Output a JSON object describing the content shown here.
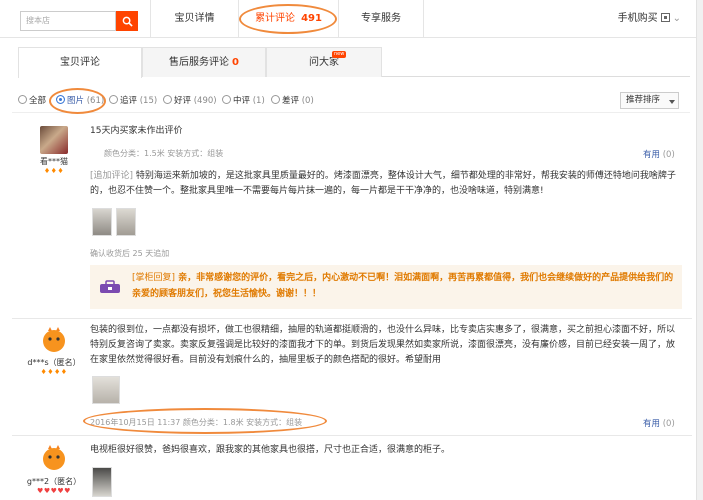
{
  "top": {
    "search_placeholder": "搜本店",
    "tabs": [
      {
        "label": "宝贝详情"
      },
      {
        "label": "累计评论",
        "count": "491"
      },
      {
        "label": "专享服务"
      }
    ],
    "mobile_buy": "手机购买"
  },
  "subtabs": [
    {
      "label": "宝贝评论"
    },
    {
      "label": "售后服务评论",
      "count": "0"
    },
    {
      "label": "问大家",
      "badge": "new"
    }
  ],
  "filters": [
    {
      "label": "全部",
      "count": ""
    },
    {
      "label": "图片",
      "count": "(61)"
    },
    {
      "label": "追评",
      "count": "(15)"
    },
    {
      "label": "好评",
      "count": "(490)"
    },
    {
      "label": "中评",
      "count": "(1)"
    },
    {
      "label": "差评",
      "count": "(0)"
    }
  ],
  "sort_label": "推荐排序",
  "reviews": [
    {
      "user": "看***猫",
      "hearts": "♦♦♦",
      "text": "15天内买家未作出评价",
      "meta": "颜色分类：1.5米     安装方式：组装",
      "useful_label": "有用",
      "useful_count": "(0)",
      "append_label": "[追加评论]",
      "append_text": "特别海运来新加坡的，是这批家具里质量最好的。烤漆面漂亮，整体设计大气，细节都处理的非常好，帮我安装的师傅还特地问我啥牌子的，也忍不住赞一个。整批家具里唯一不需要每片每片抹一遍的，每一片都是干干净净的，也没啥味道，特别满意!",
      "append_note": "确认收货后 25 天追加",
      "reply_label": "[掌柜回复]",
      "reply_text": "亲，非常感谢您的评价，看完之后，内心激动不已啊！泪如满面啊，再苦再累都值得，我们也会继续做好的产品提供给我们的亲爱的顾客朋友们，祝您生活愉快。谢谢！！！"
    },
    {
      "user": "d***s（匿名）",
      "hearts": "♦♦♦♦",
      "text": "包装的很到位，一点都没有损坏，做工也很精细，抽屉的轨道都挺顺滑的，也没什么异味，比专卖店实惠多了，很满意，买之前担心漆面不好，所以特别反复咨询了卖家。卖家反复强调是比较好的漆面我才下的单。到货后发现果然如卖家所说，漆面很漂亮，没有廉价感，目前已经安装一周了，放在家里依然觉得很好看。目前没有划痕什么的，抽屉里板子的颜色搭配的很好。希望耐用",
      "meta": "2016年10月15日 11:37     颜色分类：1.8米     安装方式：组装",
      "useful_label": "有用",
      "useful_count": "(0)"
    },
    {
      "user": "g***2（匿名）",
      "hearts": "♥♥♥♥♥",
      "text": "电视柜很好很赞，爸妈很喜欢，跟我家的其他家具也很搭，尺寸也正合适，很满意的柜子。"
    }
  ],
  "colors": {
    "accent": "#ff4400",
    "highlight_ring": "#f08a3c",
    "reply": "#e07a00",
    "link": "#3a5da8"
  }
}
